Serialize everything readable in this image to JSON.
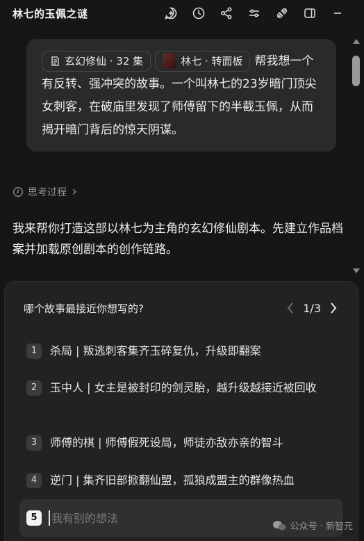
{
  "header": {
    "title": "林七的玉佩之谜",
    "toolbar_icons": [
      "add-chat-icon",
      "history-icon",
      "share-icon",
      "settings-sliders-icon",
      "plugin-icon",
      "sidebar-toggle-icon",
      "minimize-icon"
    ]
  },
  "user_message": {
    "chip_series": "玄幻修仙 · 32 集",
    "chip_character": "林七 · 转面板",
    "text": "帮我想一个有反转、强冲突的故事。一个叫林七的23岁暗门顶尖女刺客，在破庙里发现了师傅留下的半截玉佩，从而揭开暗门背后的惊天阴谋。"
  },
  "thinking": {
    "label": "思考过程"
  },
  "assistant_reply": {
    "text": "我来帮你打造这部以林七为主角的玄幻修仙剧本。先建立作品档案并加载原创剧本的创作链路。"
  },
  "question_panel": {
    "question": "哪个故事最接近你想写的?",
    "pager": "1/3",
    "options": [
      {
        "num": "1",
        "label": "杀局 | 叛逃刺客集齐玉碎复仇，升级即翻案"
      },
      {
        "num": "2",
        "label": "玉中人 | 女主是被封印的剑灵胎，越升级越接近被回收"
      },
      {
        "num": "3",
        "label": "师傅的棋 | 师傅假死设局，师徒亦敌亦亲的智斗"
      },
      {
        "num": "4",
        "label": "逆门 | 集齐旧部掀翻仙盟，孤狼成盟主的群像热血"
      }
    ],
    "custom": {
      "num": "5",
      "placeholder": "我有别的想法"
    }
  },
  "watermark": {
    "text": "公众号 · 新智元"
  },
  "colors": {
    "background": "#161616",
    "bubble": "#2a2a2a",
    "panel": "#222222",
    "text": "#e9e9e9",
    "muted": "#8d8d8d"
  }
}
